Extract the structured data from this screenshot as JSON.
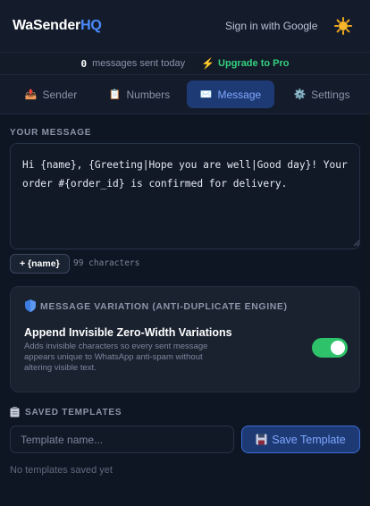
{
  "header": {
    "brand_main": "WaSender",
    "brand_suffix": "HQ",
    "signin_label": "Sign in with Google",
    "theme_icon": "sun-icon"
  },
  "status": {
    "messages_sent_count": "0",
    "messages_sent_label": "messages sent today",
    "upgrade_label": "Upgrade to Pro"
  },
  "tabs": [
    {
      "label": "Sender",
      "icon": "sender-icon",
      "active": false
    },
    {
      "label": "Numbers",
      "icon": "clipboard-icon",
      "active": false
    },
    {
      "label": "Message",
      "icon": "message-icon",
      "active": true
    },
    {
      "label": "Settings",
      "icon": "gear-icon",
      "active": false
    }
  ],
  "message": {
    "section_title": "YOUR MESSAGE",
    "text": "Hi {name}, {Greeting|Hope you are well|Good day}! Your order #{order_id} is confirmed for delivery.",
    "insert_variable_label": "+ {name}",
    "char_count_label": "99 characters"
  },
  "variation": {
    "section_title": "MESSAGE VARIATION (ANTI-DUPLICATE ENGINE)",
    "option_label": "Append Invisible Zero-Width Variations",
    "option_description": "Adds invisible characters so every sent message appears unique to WhatsApp anti-spam without altering visible text.",
    "enabled": true
  },
  "templates": {
    "section_title": "SAVED TEMPLATES",
    "input_placeholder": "Template name...",
    "input_value": "",
    "save_label": "Save Template",
    "empty_note": "No templates saved yet"
  },
  "colors": {
    "background": "#0f1623",
    "accent": "#4a8cff",
    "active_tab": "#1e3a74",
    "success": "#2ec26a",
    "warning": "#f59f1e"
  }
}
